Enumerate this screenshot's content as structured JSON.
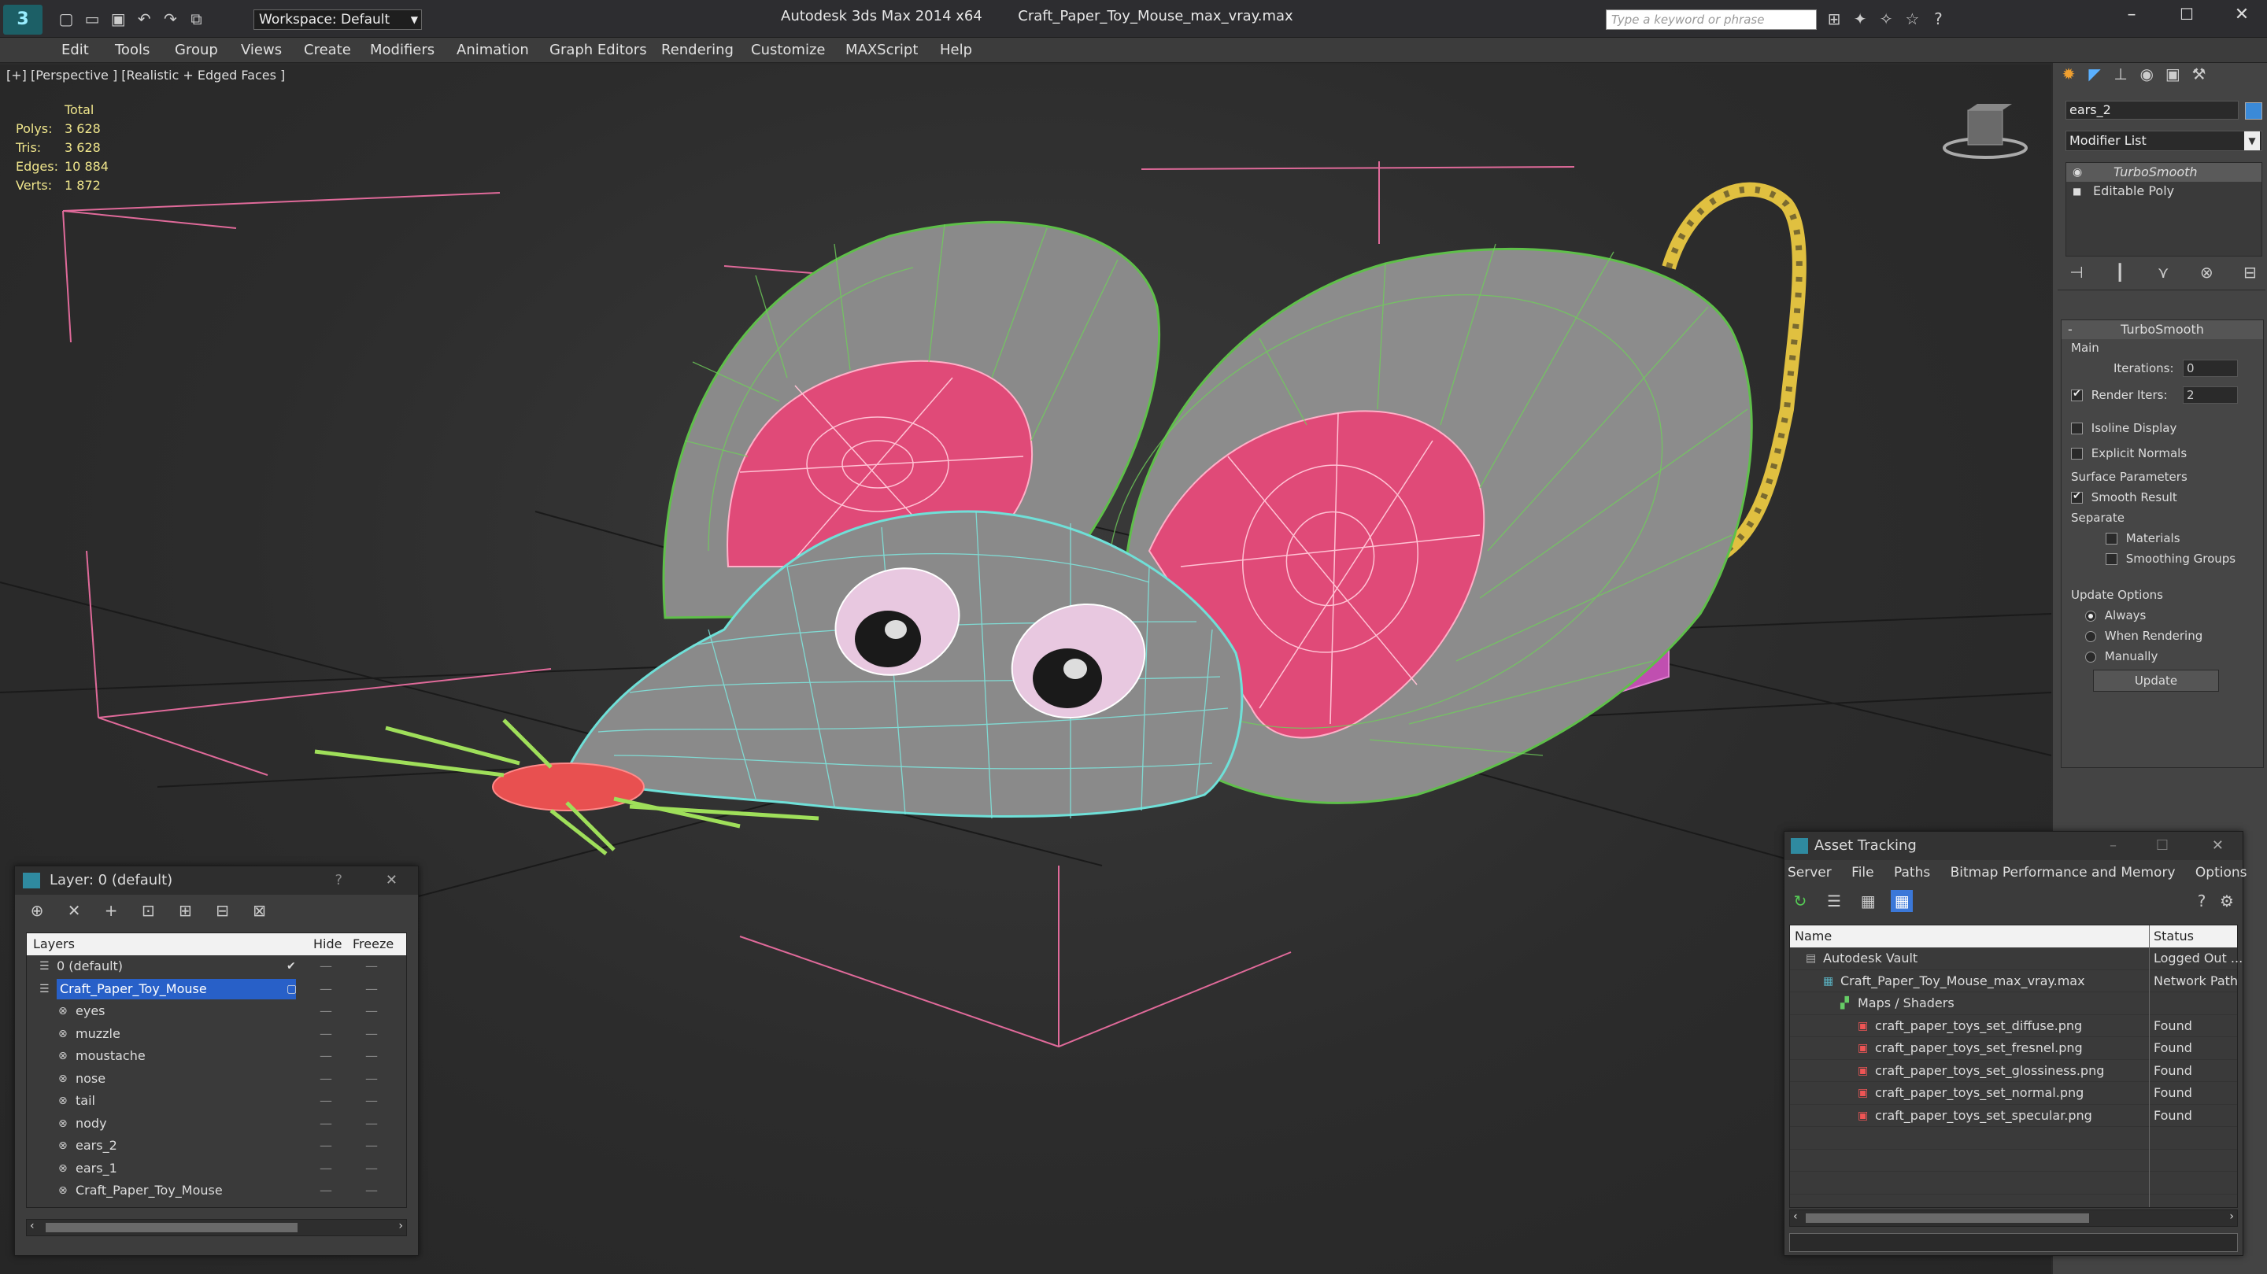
{
  "app": {
    "title": "Autodesk 3ds Max  2014 x64",
    "file": "Craft_Paper_Toy_Mouse_max_vray.max",
    "workspace": "Workspace: Default",
    "search_placeholder": "Type a keyword or phrase"
  },
  "menu": [
    "Edit",
    "Tools",
    "Group",
    "Views",
    "Create",
    "Modifiers",
    "Animation",
    "Graph Editors",
    "Rendering",
    "Customize",
    "MAXScript",
    "Help"
  ],
  "viewport": {
    "label": "[+] [Perspective ] [Realistic + Edged Faces ]",
    "stats": {
      "total_label": "Total",
      "rows": [
        {
          "k": "Polys:",
          "v": "3 628"
        },
        {
          "k": "Tris:",
          "v": "3 628"
        },
        {
          "k": "Edges:",
          "v": "10 884"
        },
        {
          "k": "Verts:",
          "v": "1 872"
        }
      ]
    }
  },
  "command_panel": {
    "object_name": "ears_2",
    "modifier_list": "Modifier List",
    "stack": [
      "TurboSmooth",
      "Editable Poly"
    ],
    "rollout_title": "TurboSmooth",
    "main_label": "Main",
    "iterations_label": "Iterations:",
    "iterations_value": "0",
    "render_iters_label": "Render Iters:",
    "render_iters_value": "2",
    "isoline_label": "Isoline Display",
    "explicit_label": "Explicit Normals",
    "surface_label": "Surface Parameters",
    "smooth_label": "Smooth Result",
    "separate_label": "Separate",
    "materials_label": "Materials",
    "smoothing_groups_label": "Smoothing Groups",
    "update_options_label": "Update Options",
    "always_label": "Always",
    "when_rendering_label": "When Rendering",
    "manually_label": "Manually",
    "update_button": "Update"
  },
  "layer_dialog": {
    "title": "Layer: 0 (default)",
    "help": "?",
    "col_layers": "Layers",
    "col_hide": "Hide",
    "col_freeze": "Freeze",
    "rows": [
      {
        "name": "0 (default)",
        "level": 1
      },
      {
        "name": "Craft_Paper_Toy_Mouse",
        "level": 1
      },
      {
        "name": "eyes",
        "level": 2
      },
      {
        "name": "muzzle",
        "level": 2
      },
      {
        "name": "moustache",
        "level": 2
      },
      {
        "name": "nose",
        "level": 2
      },
      {
        "name": "tail",
        "level": 2
      },
      {
        "name": "nody",
        "level": 2
      },
      {
        "name": "ears_2",
        "level": 2
      },
      {
        "name": "ears_1",
        "level": 2
      },
      {
        "name": "Craft_Paper_Toy_Mouse",
        "level": 2
      }
    ]
  },
  "asset_tracking": {
    "title": "Asset Tracking",
    "menu": [
      "Server",
      "File",
      "Paths",
      "Bitmap Performance and Memory",
      "Options"
    ],
    "col_name": "Name",
    "col_status": "Status",
    "rows": [
      {
        "name": "Autodesk Vault",
        "status": "Logged Out ...",
        "level": 1
      },
      {
        "name": "Craft_Paper_Toy_Mouse_max_vray.max",
        "status": "Network Path",
        "level": 2
      },
      {
        "name": "Maps / Shaders",
        "status": "",
        "level": 3
      },
      {
        "name": "craft_paper_toys_set_diffuse.png",
        "status": "Found",
        "level": 4
      },
      {
        "name": "craft_paper_toys_set_fresnel.png",
        "status": "Found",
        "level": 4
      },
      {
        "name": "craft_paper_toys_set_glossiness.png",
        "status": "Found",
        "level": 4
      },
      {
        "name": "craft_paper_toys_set_normal.png",
        "status": "Found",
        "level": 4
      },
      {
        "name": "craft_paper_toys_set_specular.png",
        "status": "Found",
        "level": 4
      }
    ]
  },
  "colors": {
    "accent_blue": "#3b78d8",
    "selection": "#2860c8",
    "stats_yellow": "#f0e68c",
    "mouse_grey": "#8a8a8a",
    "ear_pink": "#e0406a",
    "wire_green": "#7fcf5a",
    "wire_cyan": "#6fe0d8"
  }
}
